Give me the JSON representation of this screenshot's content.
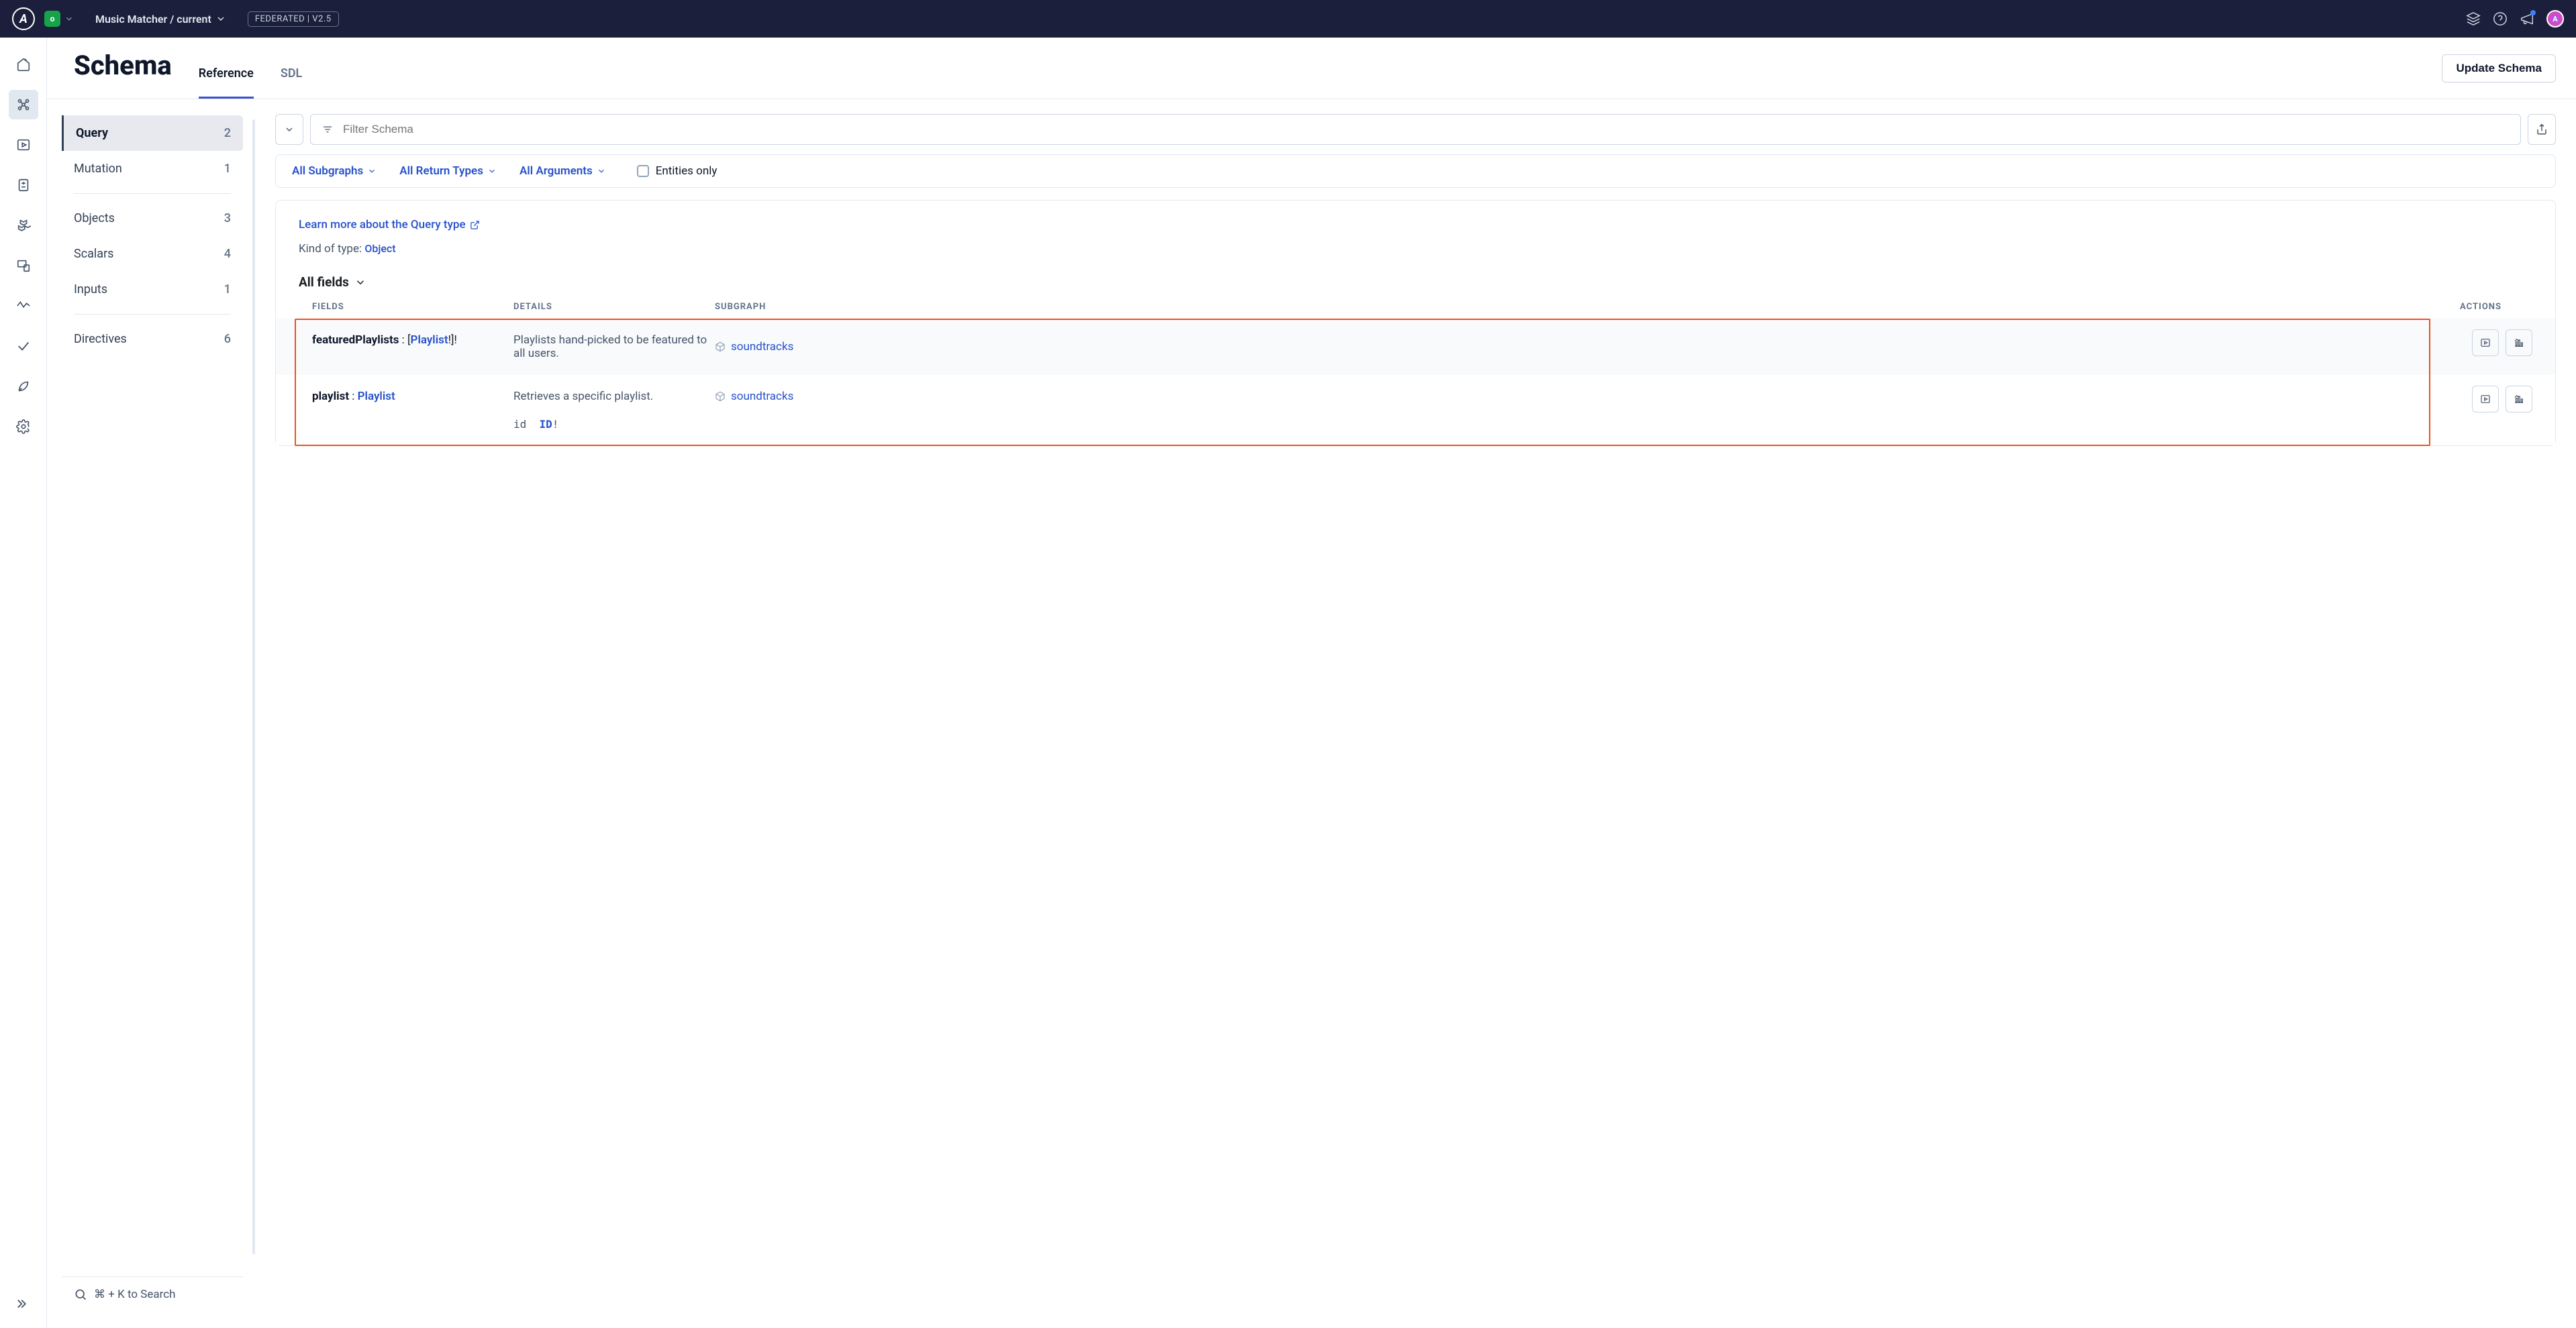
{
  "topbar": {
    "org_letter": "o",
    "graph_name": "Music Matcher / current",
    "fed_badge": "FEDERATED | V2.5"
  },
  "page": {
    "title": "Schema",
    "tabs": [
      "Reference",
      "SDL"
    ],
    "active_tab": 0,
    "update_label": "Update Schema"
  },
  "side_types": [
    {
      "name": "Query",
      "count": 2,
      "active": true
    },
    {
      "name": "Mutation",
      "count": 1
    },
    {
      "name": "Objects",
      "count": 3
    },
    {
      "name": "Scalars",
      "count": 4
    },
    {
      "name": "Inputs",
      "count": 1
    },
    {
      "name": "Directives",
      "count": 6
    }
  ],
  "search_hint": "⌘ + K to Search",
  "filterbar": {
    "placeholder": "Filter Schema"
  },
  "chips": {
    "subgraphs": "All Subgraphs",
    "return": "All Return Types",
    "args": "All Arguments",
    "entities": "Entities only"
  },
  "typecard": {
    "learn": "Learn more about the Query type",
    "kind_label": "Kind of type:",
    "kind_value": "Object",
    "allfields": "All fields",
    "cols": {
      "fields": "FIELDS",
      "details": "DETAILS",
      "subgraph": "SUBGRAPH",
      "actions": "ACTIONS"
    }
  },
  "fields": [
    {
      "name": "featuredPlaylists",
      "ret_prefix": " : [",
      "ret_type": "Playlist",
      "ret_suffix": "!]!",
      "desc": "Playlists hand-picked to be featured to all users.",
      "subgraph": "soundtracks",
      "args": []
    },
    {
      "name": "playlist",
      "ret_prefix": " : ",
      "ret_type": "Playlist",
      "ret_suffix": "",
      "desc": "Retrieves a specific playlist.",
      "subgraph": "soundtracks",
      "args": [
        {
          "name": "id",
          "type": "ID",
          "suffix": "!"
        }
      ]
    }
  ]
}
